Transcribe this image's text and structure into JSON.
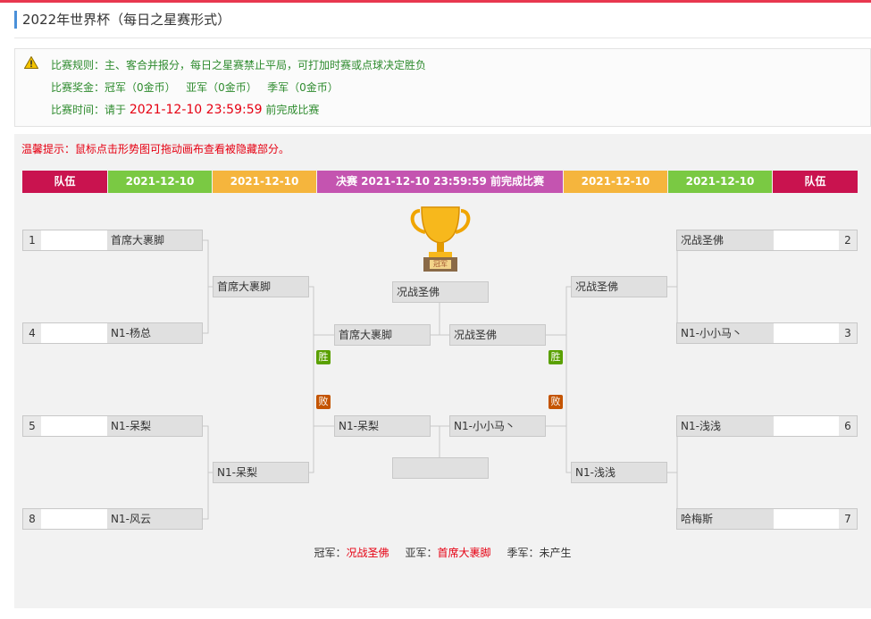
{
  "page_title": "2022年世界杯（每日之星赛形式）",
  "info": {
    "rule_label": "比赛规则：",
    "rule_text": "主、客合并报分，每日之星赛禁止平局，可打加时赛或点球决定胜负",
    "prize_label": "比赛奖金：",
    "prize_text": "冠军（0金币）   亚军（0金币）   季军（0金币）",
    "time_label": "比赛时间：",
    "time_prefix": "请于 ",
    "time_value": "2021-12-10 23:59:59",
    "time_suffix": " 前完成比赛"
  },
  "tip": "温馨提示：鼠标点击形势图可拖动画布查看被隐藏部分。",
  "headers": {
    "team_left": "队伍",
    "round1_left": "2021-12-10",
    "round2_left": "2021-12-10",
    "final": "决赛 2021-12-10 23:59:59 前完成比赛",
    "round2_right": "2021-12-10",
    "round1_right": "2021-12-10",
    "team_right": "队伍"
  },
  "colors": {
    "team": "#c9134f",
    "round1": "#7ac943",
    "round2": "#f5b53d",
    "final": "#c454b0",
    "win": "#5aa000",
    "lose": "#c45400"
  },
  "left_r1": [
    {
      "seed": "1",
      "name": "首席大裹脚"
    },
    {
      "seed": "4",
      "name": "N1-杨总"
    },
    {
      "seed": "5",
      "name": "N1-呆梨"
    },
    {
      "seed": "8",
      "name": "N1-风云"
    }
  ],
  "right_r1": [
    {
      "seed": "2",
      "name": "况战圣佛"
    },
    {
      "seed": "3",
      "name": "N1-小小马丶"
    },
    {
      "seed": "6",
      "name": "N1-浅浅"
    },
    {
      "seed": "7",
      "name": "哈梅斯"
    }
  ],
  "left_r2": [
    "首席大裹脚",
    "N1-呆梨"
  ],
  "right_r2": [
    "况战圣佛",
    "N1-浅浅"
  ],
  "semis": {
    "win_left": "首席大裹脚",
    "win_right": "况战圣佛",
    "lose_left": "N1-呆梨",
    "lose_right": "N1-小小马丶"
  },
  "champion_box": "况战圣佛",
  "third_box": "",
  "trophy_label": "冠军",
  "win_badge": "胜",
  "lose_badge": "败",
  "final_result": {
    "champion_label": "冠军：",
    "champion": "况战圣佛",
    "runner_label": "亚军：",
    "runner": "首席大裹脚",
    "third_label": "季军：",
    "third": "未产生"
  }
}
